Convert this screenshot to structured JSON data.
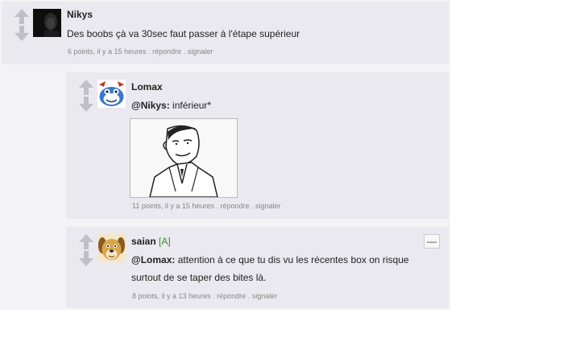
{
  "comments": [
    {
      "username": "Nikys",
      "avatar_icon": "dark-hooded-avatar",
      "text": "Des boobs çà va 30sec faut passer à l'étape supérieur",
      "meta": {
        "points": "6 points",
        "time": "il y a 15 heures",
        "reply": "répondre",
        "report": "signaler",
        "sep": "."
      }
    },
    {
      "username": "Lomax",
      "avatar_icon": "blue-cartoon-avatar",
      "mention": "@Nikys:",
      "text": " inférieur*",
      "image_icon": "if-you-know-what-i-mean-meme",
      "meta": {
        "points": "11 points",
        "time": "il y a 15 heures",
        "reply": "répondre",
        "report": "signaler",
        "sep": "."
      }
    },
    {
      "username": "saian",
      "mod_tag": "[A]",
      "avatar_icon": "cartoon-dog-avatar",
      "mention": "@Lomax:",
      "text_line1": " attention à ce que tu dis vu les récentes box on risque",
      "text_line2": "surtout de se taper des bites là.",
      "collapse_label": "—",
      "meta": {
        "points": "8 points",
        "time": "il y a 13 heures",
        "reply": "répondre",
        "report": "signaler",
        "sep": "."
      }
    }
  ],
  "colors": {
    "panel": "#e9e9ef",
    "thread_bg": "#f3f3f5",
    "meta_text": "#888888",
    "mod_tag": "#3a8a2e",
    "vote_arrow": "#bfbfc4"
  }
}
